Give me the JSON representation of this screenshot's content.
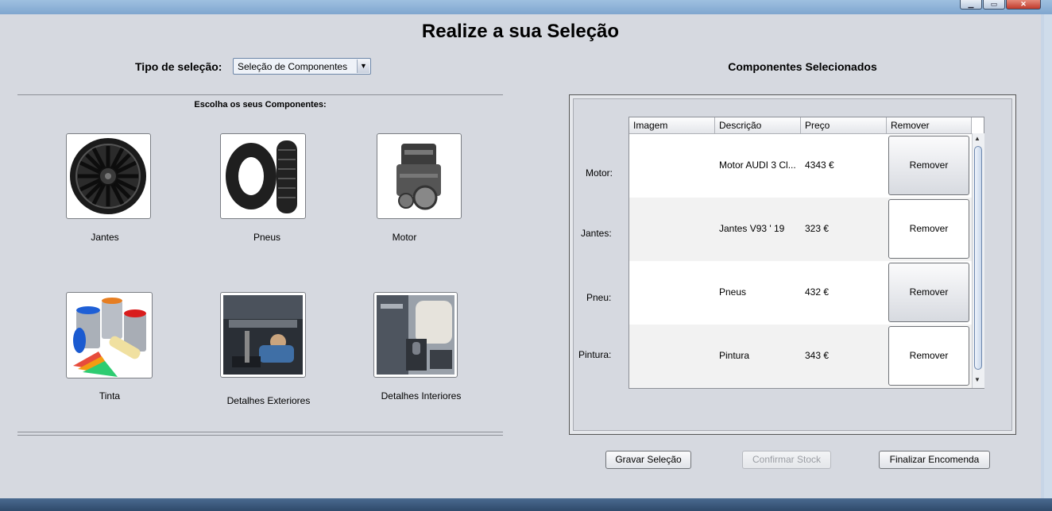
{
  "window": {
    "minimize": "▁",
    "maximize": "▭",
    "close": "✕"
  },
  "header": {
    "title": "Realize a sua Seleção"
  },
  "selection_type": {
    "label": "Tipo de seleção:",
    "value": "Seleção de Componentes"
  },
  "components": {
    "heading": "Escolha os seus Componentes:",
    "items": [
      {
        "label": "Jantes",
        "icon": "wheel-rim-icon"
      },
      {
        "label": "Pneus",
        "icon": "tyre-icon"
      },
      {
        "label": "Motor",
        "icon": "engine-icon"
      },
      {
        "label": "Tinta",
        "icon": "paint-cans-icon"
      },
      {
        "label": "Detalhes Exteriores",
        "icon": "mechanic-icon"
      },
      {
        "label": "Detalhes Interiores",
        "icon": "car-interior-icon"
      }
    ]
  },
  "selected": {
    "heading": "Componentes Selecionados",
    "columns": [
      "Imagem",
      "Descrição",
      "Preço",
      "Remover"
    ],
    "rows": [
      {
        "label": "Motor:",
        "description": "Motor AUDI 3 Cl...",
        "price": "4343 €",
        "remove": "Remover"
      },
      {
        "label": "Jantes:",
        "description": "Jantes V93 ' 19",
        "price": "323 €",
        "remove": "Remover"
      },
      {
        "label": "Pneu:",
        "description": "Pneus",
        "price": "432 €",
        "remove": "Remover"
      },
      {
        "label": "Pintura:",
        "description": "Pintura",
        "price": "343 €",
        "remove": "Remover"
      }
    ]
  },
  "actions": {
    "save": "Gravar Seleção",
    "confirm_stock": "Confirmar Stock",
    "finish": "Finalizar Encomenda"
  }
}
